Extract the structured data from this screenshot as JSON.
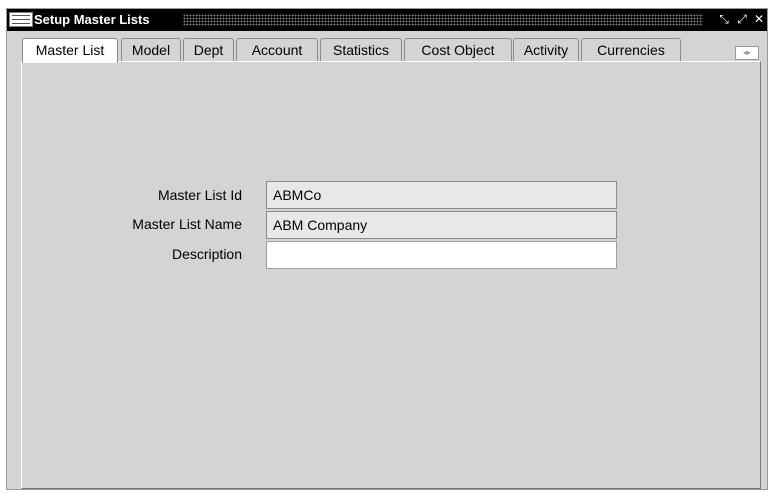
{
  "window": {
    "title": "Setup Master Lists",
    "controls": {
      "minimize": "⤡",
      "maximize": "⤢",
      "close": "✕"
    }
  },
  "tabs": [
    {
      "label": "Master List",
      "active": true
    },
    {
      "label": "Model",
      "active": false
    },
    {
      "label": "Dept",
      "active": false
    },
    {
      "label": "Account",
      "active": false
    },
    {
      "label": "Statistics",
      "active": false
    },
    {
      "label": "Cost Object",
      "active": false
    },
    {
      "label": "Activity",
      "active": false
    },
    {
      "label": "Currencies",
      "active": false
    }
  ],
  "tab_scroll": "◂▸",
  "form": {
    "master_list_id": {
      "label": "Master List Id",
      "value": "ABMCo"
    },
    "master_list_name": {
      "label": "Master List Name",
      "value": "ABM Company"
    },
    "description": {
      "label": "Description",
      "value": ""
    }
  }
}
